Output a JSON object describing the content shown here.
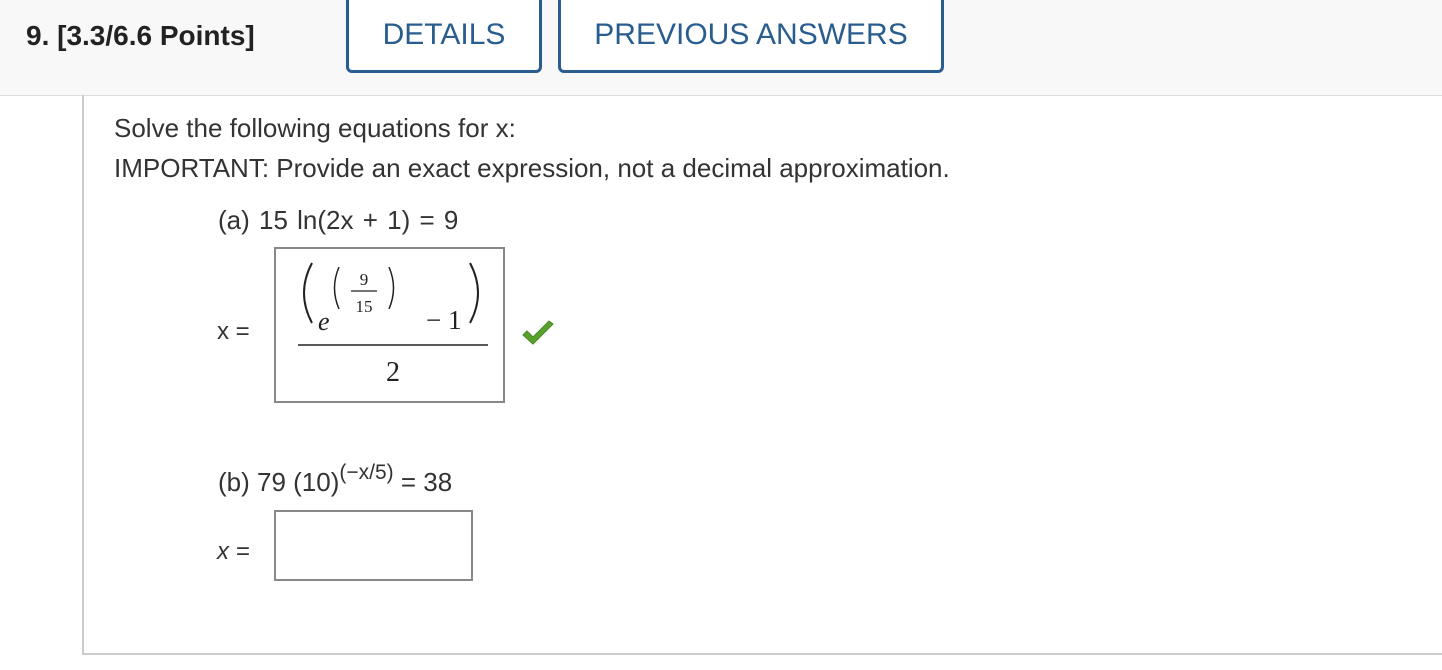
{
  "header": {
    "question_title": "9.  [3.3/6.6 Points]",
    "details_label": "DETAILS",
    "previous_answers_label": "PREVIOUS ANSWERS"
  },
  "instructions": {
    "line1": "Solve the following equations for x:",
    "line2": "IMPORTANT: Provide an exact expression, not a decimal approximation."
  },
  "part_a": {
    "prompt": "(a) 15 ln(2x + 1) = 9",
    "x_label": "x =",
    "answer": {
      "base": "e",
      "exp_numerator": "9",
      "exp_denominator": "15",
      "minus_one": "− 1",
      "denominator": "2"
    },
    "status": "correct",
    "status_color": "#5aa02c"
  },
  "part_b": {
    "prompt_prefix": "(b)  79 (10)",
    "prompt_exponent": "(−x/5)",
    "prompt_suffix": " = 38",
    "x_label": "x =",
    "input_value": ""
  },
  "colors": {
    "accent": "#2a5d8f",
    "header_bg": "#f8f8f8",
    "border": "#cccccc"
  }
}
